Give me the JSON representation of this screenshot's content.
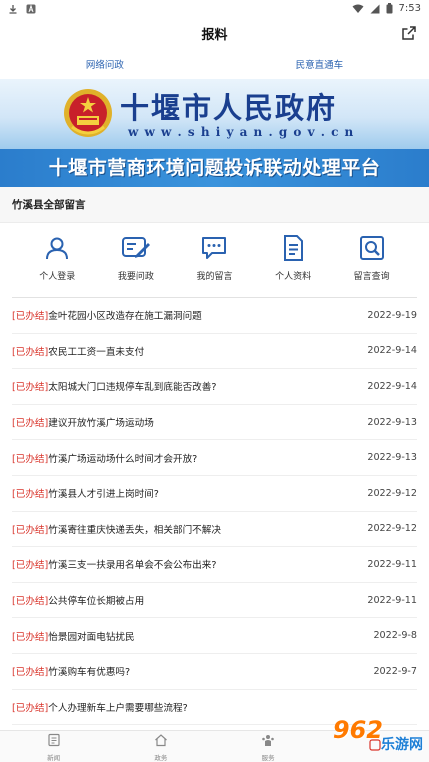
{
  "status_bar": {
    "time": "7:53"
  },
  "header": {
    "title": "报料"
  },
  "top_tabs": [
    "网络问政",
    "民意直通车"
  ],
  "banner": {
    "gov_name": "十堰市人民政府",
    "gov_url": "w w w . s h i y a n . g o v . c n",
    "platform": "十堰市营商环境问题投诉联动处理平台"
  },
  "section": {
    "title": "竹溪县全部留言"
  },
  "menu": [
    {
      "label": "个人登录",
      "icon": "user-icon"
    },
    {
      "label": "我要问政",
      "icon": "edit-icon"
    },
    {
      "label": "我的留言",
      "icon": "chat-icon"
    },
    {
      "label": "个人资料",
      "icon": "document-icon"
    },
    {
      "label": "留言查询",
      "icon": "search-icon"
    }
  ],
  "messages": [
    {
      "status": "[已办结]",
      "title": "金叶花园小区改造存在施工漏洞问题",
      "date": "2022-9-19"
    },
    {
      "status": "[已办结]",
      "title": "农民工工资一直未支付",
      "date": "2022-9-14"
    },
    {
      "status": "[已办结]",
      "title": "太阳城大门口违规停车乱到底能否改善?",
      "date": "2022-9-14"
    },
    {
      "status": "[已办结]",
      "title": "建议开放竹溪广场运动场",
      "date": "2022-9-13"
    },
    {
      "status": "[已办结]",
      "title": "竹溪广场运动场什么时间才会开放?",
      "date": "2022-9-13"
    },
    {
      "status": "[已办结]",
      "title": "竹溪县人才引进上岗时间?",
      "date": "2022-9-12"
    },
    {
      "status": "[已办结]",
      "title": "竹溪寄往重庆快递丢失，相关部门不解决",
      "date": "2022-9-12"
    },
    {
      "status": "[已办结]",
      "title": "竹溪三支一扶录用名单会不会公布出来?",
      "date": "2022-9-11"
    },
    {
      "status": "[已办结]",
      "title": "公共停车位长期被占用",
      "date": "2022-9-11"
    },
    {
      "status": "[已办结]",
      "title": "怡景园对面电钻扰民",
      "date": "2022-9-8"
    },
    {
      "status": "[已办结]",
      "title": "竹溪购车有优惠吗?",
      "date": "2022-9-7"
    },
    {
      "status": "[已办结]",
      "title": "个人办理新车上户需要哪些流程?",
      "date": ""
    }
  ],
  "bottom_nav": [
    {
      "label": "新闻",
      "icon": "news-icon"
    },
    {
      "label": "政务",
      "icon": "home-icon"
    },
    {
      "label": "服务",
      "icon": "people-icon"
    },
    {
      "label": "",
      "icon": "tab-icon"
    }
  ],
  "watermark": {
    "number": "962",
    "text": "乐游网"
  },
  "colors": {
    "accent": "#2a62b0",
    "status_red": "#d9342b",
    "banner_blue": "#3c8fd9"
  }
}
